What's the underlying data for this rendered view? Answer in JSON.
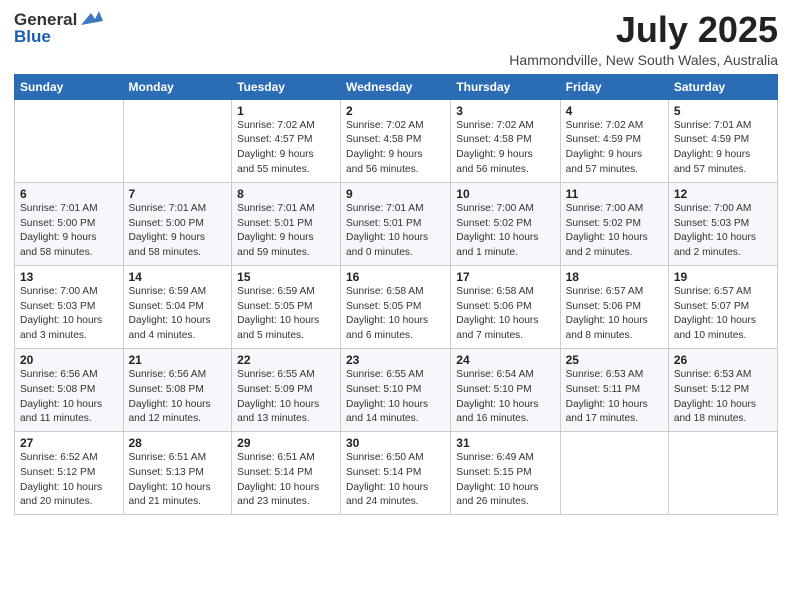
{
  "header": {
    "logo_general": "General",
    "logo_blue": "Blue",
    "month": "July 2025",
    "location": "Hammondville, New South Wales, Australia"
  },
  "weekdays": [
    "Sunday",
    "Monday",
    "Tuesday",
    "Wednesday",
    "Thursday",
    "Friday",
    "Saturday"
  ],
  "weeks": [
    [
      {
        "day": "",
        "info": ""
      },
      {
        "day": "",
        "info": ""
      },
      {
        "day": "1",
        "info": "Sunrise: 7:02 AM\nSunset: 4:57 PM\nDaylight: 9 hours\nand 55 minutes."
      },
      {
        "day": "2",
        "info": "Sunrise: 7:02 AM\nSunset: 4:58 PM\nDaylight: 9 hours\nand 56 minutes."
      },
      {
        "day": "3",
        "info": "Sunrise: 7:02 AM\nSunset: 4:58 PM\nDaylight: 9 hours\nand 56 minutes."
      },
      {
        "day": "4",
        "info": "Sunrise: 7:02 AM\nSunset: 4:59 PM\nDaylight: 9 hours\nand 57 minutes."
      },
      {
        "day": "5",
        "info": "Sunrise: 7:01 AM\nSunset: 4:59 PM\nDaylight: 9 hours\nand 57 minutes."
      }
    ],
    [
      {
        "day": "6",
        "info": "Sunrise: 7:01 AM\nSunset: 5:00 PM\nDaylight: 9 hours\nand 58 minutes."
      },
      {
        "day": "7",
        "info": "Sunrise: 7:01 AM\nSunset: 5:00 PM\nDaylight: 9 hours\nand 58 minutes."
      },
      {
        "day": "8",
        "info": "Sunrise: 7:01 AM\nSunset: 5:01 PM\nDaylight: 9 hours\nand 59 minutes."
      },
      {
        "day": "9",
        "info": "Sunrise: 7:01 AM\nSunset: 5:01 PM\nDaylight: 10 hours\nand 0 minutes."
      },
      {
        "day": "10",
        "info": "Sunrise: 7:00 AM\nSunset: 5:02 PM\nDaylight: 10 hours\nand 1 minute."
      },
      {
        "day": "11",
        "info": "Sunrise: 7:00 AM\nSunset: 5:02 PM\nDaylight: 10 hours\nand 2 minutes."
      },
      {
        "day": "12",
        "info": "Sunrise: 7:00 AM\nSunset: 5:03 PM\nDaylight: 10 hours\nand 2 minutes."
      }
    ],
    [
      {
        "day": "13",
        "info": "Sunrise: 7:00 AM\nSunset: 5:03 PM\nDaylight: 10 hours\nand 3 minutes."
      },
      {
        "day": "14",
        "info": "Sunrise: 6:59 AM\nSunset: 5:04 PM\nDaylight: 10 hours\nand 4 minutes."
      },
      {
        "day": "15",
        "info": "Sunrise: 6:59 AM\nSunset: 5:05 PM\nDaylight: 10 hours\nand 5 minutes."
      },
      {
        "day": "16",
        "info": "Sunrise: 6:58 AM\nSunset: 5:05 PM\nDaylight: 10 hours\nand 6 minutes."
      },
      {
        "day": "17",
        "info": "Sunrise: 6:58 AM\nSunset: 5:06 PM\nDaylight: 10 hours\nand 7 minutes."
      },
      {
        "day": "18",
        "info": "Sunrise: 6:57 AM\nSunset: 5:06 PM\nDaylight: 10 hours\nand 8 minutes."
      },
      {
        "day": "19",
        "info": "Sunrise: 6:57 AM\nSunset: 5:07 PM\nDaylight: 10 hours\nand 10 minutes."
      }
    ],
    [
      {
        "day": "20",
        "info": "Sunrise: 6:56 AM\nSunset: 5:08 PM\nDaylight: 10 hours\nand 11 minutes."
      },
      {
        "day": "21",
        "info": "Sunrise: 6:56 AM\nSunset: 5:08 PM\nDaylight: 10 hours\nand 12 minutes."
      },
      {
        "day": "22",
        "info": "Sunrise: 6:55 AM\nSunset: 5:09 PM\nDaylight: 10 hours\nand 13 minutes."
      },
      {
        "day": "23",
        "info": "Sunrise: 6:55 AM\nSunset: 5:10 PM\nDaylight: 10 hours\nand 14 minutes."
      },
      {
        "day": "24",
        "info": "Sunrise: 6:54 AM\nSunset: 5:10 PM\nDaylight: 10 hours\nand 16 minutes."
      },
      {
        "day": "25",
        "info": "Sunrise: 6:53 AM\nSunset: 5:11 PM\nDaylight: 10 hours\nand 17 minutes."
      },
      {
        "day": "26",
        "info": "Sunrise: 6:53 AM\nSunset: 5:12 PM\nDaylight: 10 hours\nand 18 minutes."
      }
    ],
    [
      {
        "day": "27",
        "info": "Sunrise: 6:52 AM\nSunset: 5:12 PM\nDaylight: 10 hours\nand 20 minutes."
      },
      {
        "day": "28",
        "info": "Sunrise: 6:51 AM\nSunset: 5:13 PM\nDaylight: 10 hours\nand 21 minutes."
      },
      {
        "day": "29",
        "info": "Sunrise: 6:51 AM\nSunset: 5:14 PM\nDaylight: 10 hours\nand 23 minutes."
      },
      {
        "day": "30",
        "info": "Sunrise: 6:50 AM\nSunset: 5:14 PM\nDaylight: 10 hours\nand 24 minutes."
      },
      {
        "day": "31",
        "info": "Sunrise: 6:49 AM\nSunset: 5:15 PM\nDaylight: 10 hours\nand 26 minutes."
      },
      {
        "day": "",
        "info": ""
      },
      {
        "day": "",
        "info": ""
      }
    ]
  ]
}
